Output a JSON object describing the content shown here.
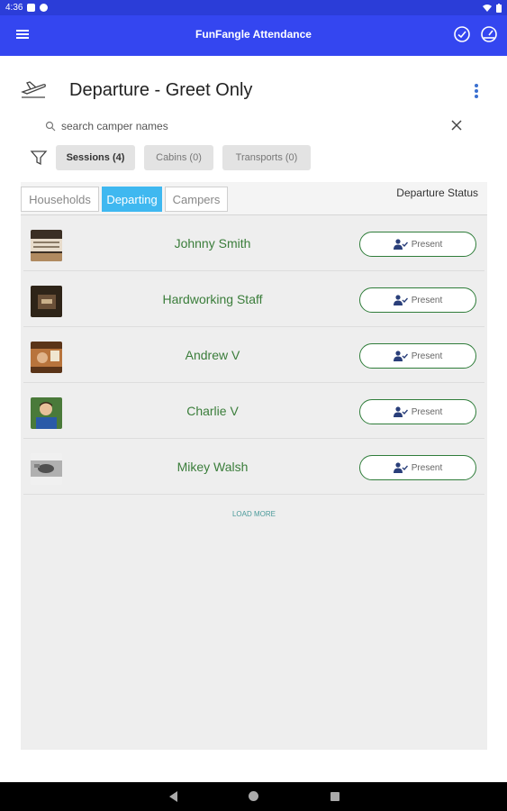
{
  "status_bar": {
    "time": "4:36"
  },
  "app_bar": {
    "title": "FunFangle Attendance",
    "menu_icon": "menu-icon",
    "right_icons": [
      "check-circle-icon",
      "speedometer-icon"
    ]
  },
  "page": {
    "title": "Departure - Greet Only",
    "icon": "airplane-departure-icon"
  },
  "search": {
    "placeholder": "search camper names",
    "value": ""
  },
  "filters": [
    {
      "label": "Sessions (4)",
      "active": true
    },
    {
      "label": "Cabins (0)",
      "active": false
    },
    {
      "label": "Transports (0)",
      "active": false
    }
  ],
  "tabs": [
    {
      "label": "Households",
      "active": false
    },
    {
      "label": "Departing",
      "active": true
    },
    {
      "label": "Campers",
      "active": false
    }
  ],
  "table": {
    "status_header": "Departure Status",
    "rows": [
      {
        "name": "Johnny Smith",
        "status": "Present"
      },
      {
        "name": "Hardworking Staff",
        "status": "Present"
      },
      {
        "name": "Andrew V",
        "status": "Present"
      },
      {
        "name": "Charlie V",
        "status": "Present"
      },
      {
        "name": "Mikey Walsh",
        "status": "Present"
      }
    ]
  },
  "load_more": "LOAD MORE",
  "colors": {
    "app_bar": "#3446f0",
    "status_bar": "#2b3dd8",
    "active_tab": "#3fb8f0",
    "name_green": "#3a7d3a"
  }
}
